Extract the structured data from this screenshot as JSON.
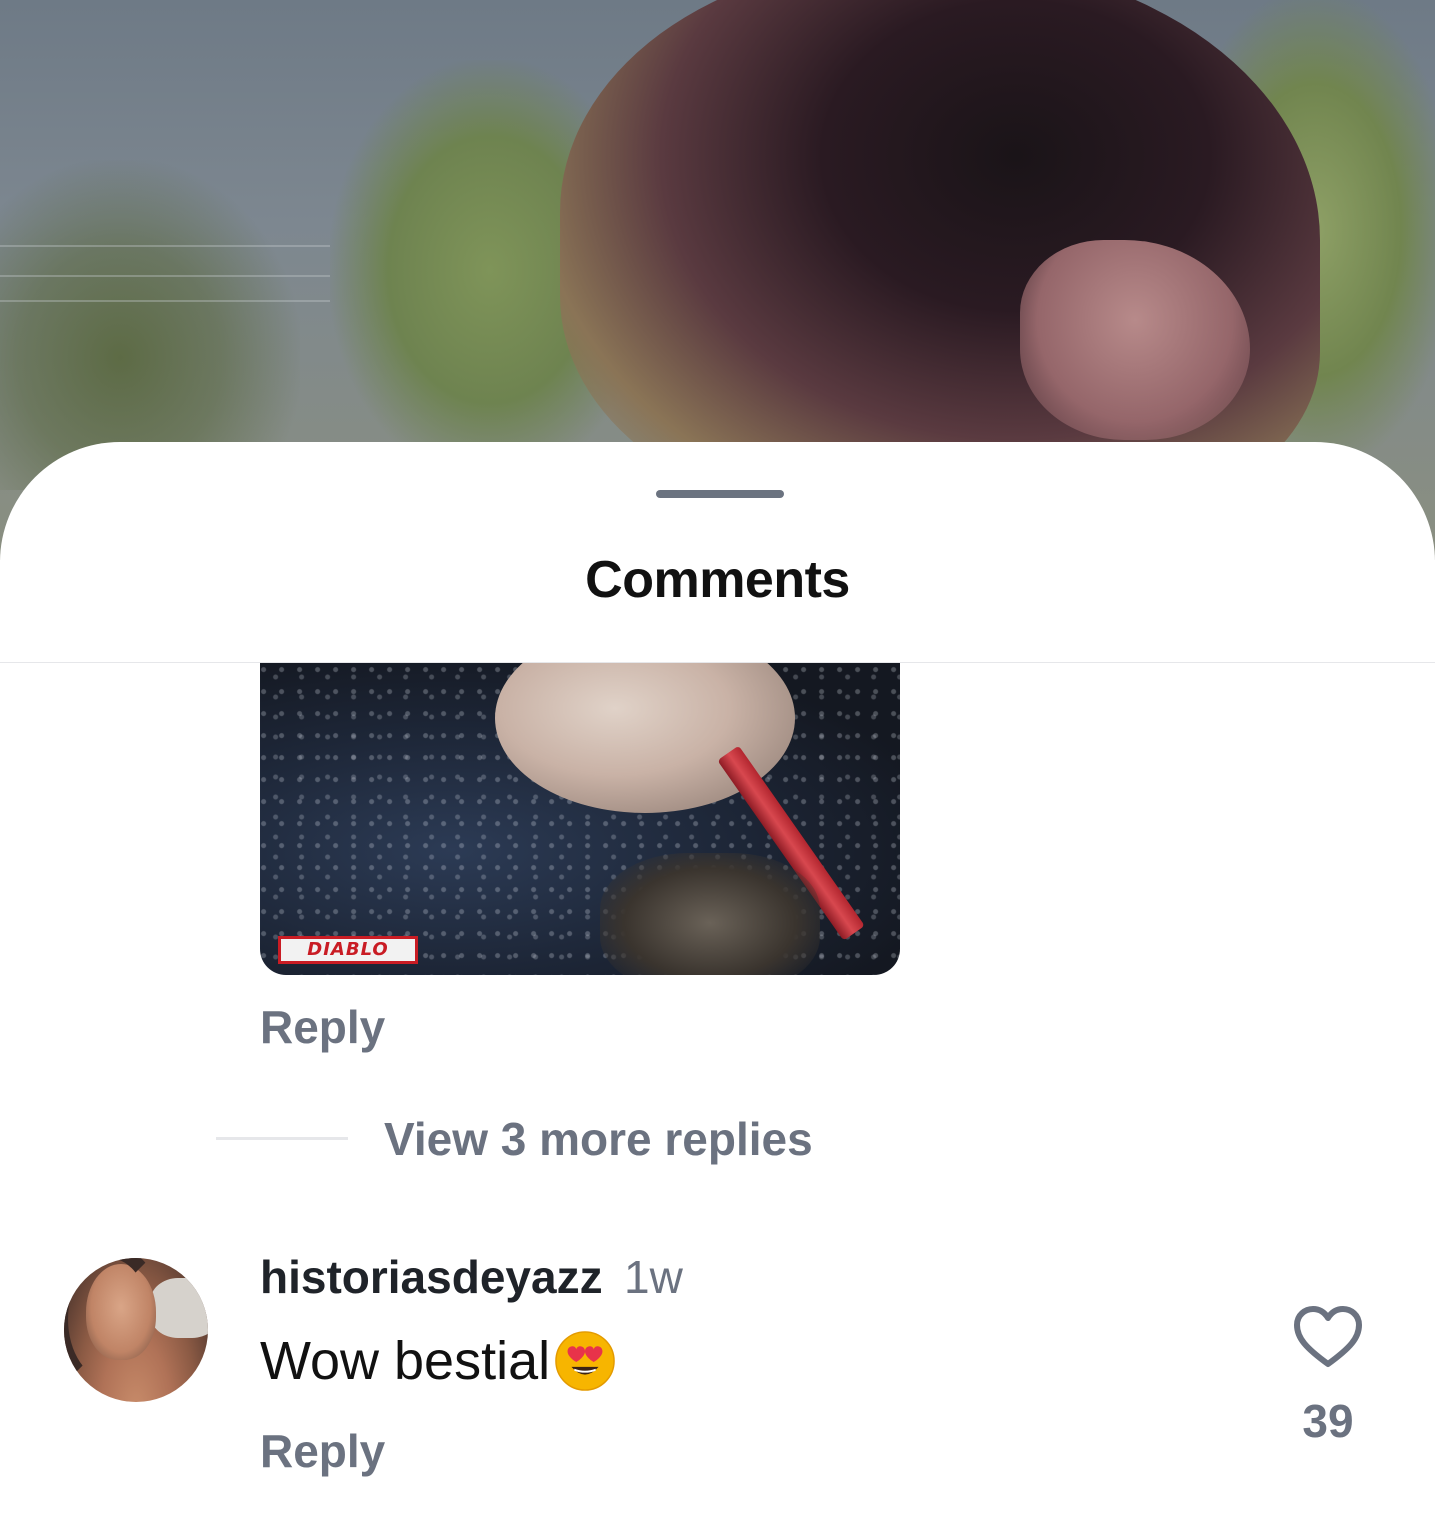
{
  "sheet": {
    "title": "Comments"
  },
  "attachment": {
    "logo_text": "DIABLO"
  },
  "thread": {
    "reply_label": "Reply",
    "more_replies_label": "View 3 more replies"
  },
  "comment": {
    "username": "historiasdeyazz",
    "timestamp": "1w",
    "text": "Wow bestial",
    "emoji": "smiling-face-with-heart-eyes",
    "reply_label": "Reply",
    "like_count": "39"
  },
  "colors": {
    "text_primary": "#111111",
    "text_secondary": "#6b7280",
    "divider": "#e6e7ea",
    "emoji_yellow": "#f7b500",
    "heart_red": "#e8334a"
  },
  "icons": {
    "like": "heart-outline-icon",
    "drag": "drag-handle"
  }
}
